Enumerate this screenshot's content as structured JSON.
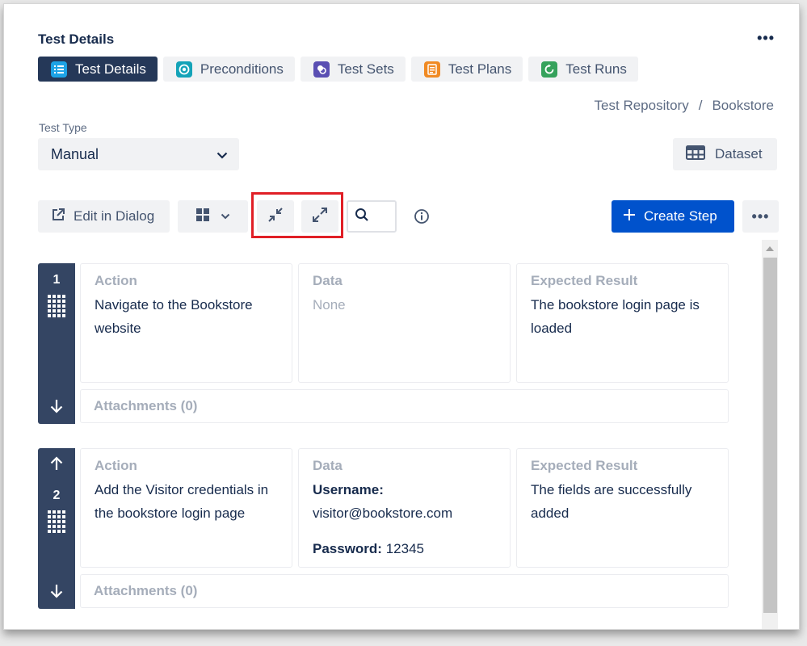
{
  "section_title": "Test Details",
  "tabs": [
    {
      "label": "Test Details",
      "icon": "list-icon",
      "color": "#1da3e6"
    },
    {
      "label": "Preconditions",
      "icon": "precondition-icon",
      "color": "#14a3b8"
    },
    {
      "label": "Test Sets",
      "icon": "test-sets-icon",
      "color": "#5a4fb3"
    },
    {
      "label": "Test Plans",
      "icon": "test-plans-icon",
      "color": "#f08a24"
    },
    {
      "label": "Test Runs",
      "icon": "test-runs-icon",
      "color": "#36a25c"
    }
  ],
  "breadcrumb": {
    "root": "Test Repository",
    "separator": "/",
    "leaf": "Bookstore"
  },
  "test_type": {
    "label": "Test Type",
    "value": "Manual"
  },
  "dataset_label": "Dataset",
  "toolbar": {
    "edit_label": "Edit in Dialog",
    "create_label": "Create Step"
  },
  "steps": [
    {
      "number": "1",
      "action_head": "Action",
      "action": "Navigate to the Bookstore website",
      "data_head": "Data",
      "data": "None",
      "result_head": "Expected Result",
      "result": "The bookstore login page is loaded",
      "attachments": "Attachments (0)"
    },
    {
      "number": "2",
      "action_head": "Action",
      "action": "Add the Visitor credentials in the bookstore login page",
      "data_head": "Data",
      "username_label": "Username:",
      "username_value": "visitor@bookstore.com",
      "password_label": "Password:",
      "password_value": "12345",
      "result_head": "Expected Result",
      "result": "The fields are successfully added",
      "attachments": "Attachments (0)"
    }
  ],
  "colors": {
    "accent": "#0052cc",
    "rail": "#344563",
    "active_tab": "#253858",
    "highlight": "#e01f26"
  }
}
